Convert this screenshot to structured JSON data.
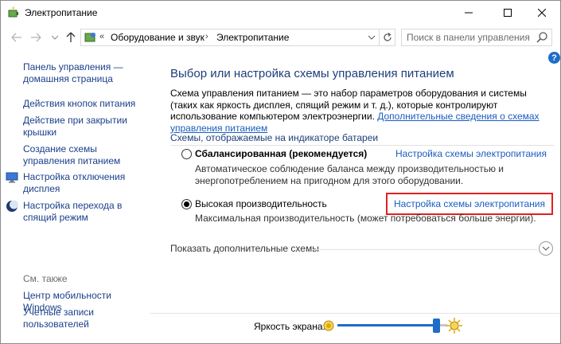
{
  "window": {
    "title": "Электропитание"
  },
  "nav": {
    "breadcrumb_root_sep": "«",
    "crumbs": [
      "Оборудование и звук",
      "Электропитание"
    ],
    "crumb_sep": "›",
    "search_placeholder": "Поиск в панели управления"
  },
  "sidebar": {
    "items": [
      {
        "label": "Панель управления — домашняя страница"
      },
      {
        "label": "Действия кнопок питания"
      },
      {
        "label": "Действие при закрытии крышки"
      },
      {
        "label": "Создание схемы управления питанием"
      },
      {
        "label": "Настройка отключения дисплея",
        "icon": "monitor-icon"
      },
      {
        "label": "Настройка перехода в спящий режим",
        "icon": "moon-icon"
      }
    ],
    "see_also_title": "См. также",
    "see_also": [
      {
        "label": "Центр мобильности Windows"
      },
      {
        "label": "Учетные записи пользователей"
      }
    ]
  },
  "main": {
    "help_label": "?",
    "heading": "Выбор или настройка схемы управления питанием",
    "intro_text": "Схема управления питанием — это набор параметров оборудования и системы (таких как яркость дисплея, спящий режим и т. д.), которые контролируют использование компьютером электроэнергии.",
    "intro_link": "Дополнительные сведения о схемах управления питанием",
    "section_title": "Схемы, отображаемые на индикаторе батареи",
    "plans": [
      {
        "name": "Сбалансированная (рекомендуется)",
        "selected": false,
        "link": "Настройка схемы электропитания",
        "description": "Автоматическое соблюдение баланса между производительностью и энергопотреблением на пригодном для этого оборудовании."
      },
      {
        "name": "Высокая производительность",
        "selected": true,
        "link": "Настройка схемы электропитания",
        "description": "Максимальная производительность (может потребоваться больше энергии)."
      }
    ],
    "more_plans": "Показать дополнительные схемы"
  },
  "brightness": {
    "label": "Яркость экрана:",
    "level_percent": 90
  },
  "colors": {
    "accent": "#1e6dc8",
    "link": "#1a5cc0",
    "heading": "#1e3e7a",
    "highlight": "#e02020"
  }
}
